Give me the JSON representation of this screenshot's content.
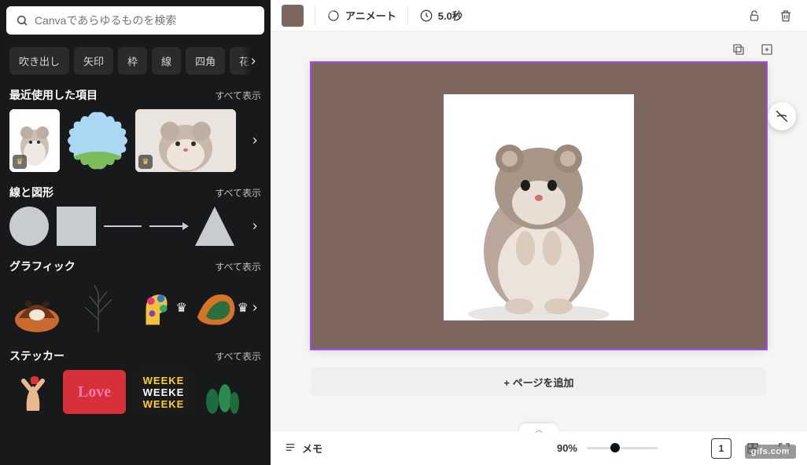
{
  "search": {
    "placeholder": "Canvaであらゆるものを検索"
  },
  "chips": [
    "吹き出し",
    "矢印",
    "枠",
    "線",
    "四角",
    "花"
  ],
  "sections": {
    "recent": {
      "title": "最近使用した項目",
      "see_all": "すべて表示"
    },
    "lines": {
      "title": "線と図形",
      "see_all": "すべて表示"
    },
    "graphics": {
      "title": "グラフィック",
      "see_all": "すべて表示"
    },
    "stickers": {
      "title": "ステッカー",
      "see_all": "すべて表示"
    }
  },
  "topbar": {
    "color": "#7c665e",
    "animate": "アニメート",
    "duration": "5.0秒"
  },
  "canvas": {
    "add_page": "+ ページを追加"
  },
  "bottombar": {
    "notes": "メモ",
    "zoom": "90%",
    "page": "1"
  },
  "watermark": "gifs.com",
  "stickers_weekend": "WEEKE",
  "stickers_love": "Love"
}
